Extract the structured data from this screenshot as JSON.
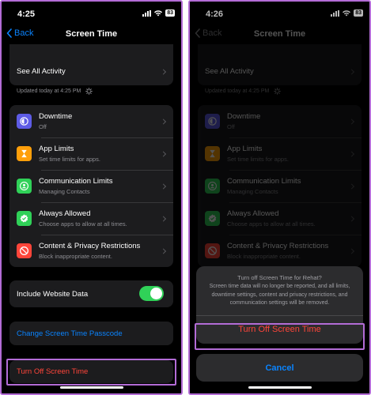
{
  "left": {
    "time": "4:25",
    "battery": "83",
    "nav": {
      "back": "Back",
      "title": "Screen Time"
    },
    "see_all": "See All Activity",
    "updated": "Updated today at 4:25 PM",
    "items": [
      {
        "title": "Downtime",
        "subtitle": "Off",
        "color": "#5e5ce6",
        "icon": "downtime-icon"
      },
      {
        "title": "App Limits",
        "subtitle": "Set time limits for apps.",
        "color": "#ff9f0a",
        "icon": "hourglass-icon"
      },
      {
        "title": "Communication Limits",
        "subtitle": "Managing Contacts",
        "color": "#30d158",
        "icon": "contact-icon"
      },
      {
        "title": "Always Allowed",
        "subtitle": "Choose apps to allow at all times.",
        "color": "#30d158",
        "icon": "checkmark-icon"
      },
      {
        "title": "Content & Privacy Restrictions",
        "subtitle": "Block inappropriate content.",
        "color": "#ff453a",
        "icon": "no-entry-icon"
      }
    ],
    "website_data": "Include Website Data",
    "website_data_on": true,
    "passcode": "Change Screen Time Passcode",
    "turn_off": "Turn Off Screen Time"
  },
  "right": {
    "time": "4:26",
    "battery": "83",
    "nav": {
      "back": "Back",
      "title": "Screen Time"
    },
    "see_all": "See All Activity",
    "updated": "Updated today at 4:25 PM",
    "items": [
      {
        "title": "Downtime",
        "subtitle": "Off"
      },
      {
        "title": "App Limits",
        "subtitle": "Set time limits for apps."
      },
      {
        "title": "Communication Limits",
        "subtitle": "Managing Contacts"
      },
      {
        "title": "Always Allowed",
        "subtitle": "Choose apps to allow at all times."
      },
      {
        "title": "Content & Privacy Restrictions",
        "subtitle": "Block inappropriate content."
      }
    ],
    "sheet": {
      "title": "Turn off Screen Time for Rehat?",
      "message": "Screen time data will no longer be reported, and all limits, downtime settings, content and privacy restrictions, and communication settings will be removed.",
      "confirm": "Turn Off Screen Time",
      "cancel": "Cancel"
    }
  },
  "colors": {
    "highlight": "#b36cd6",
    "link": "#0a84ff",
    "destructive": "#ff453a",
    "toggle_on": "#30d158"
  }
}
